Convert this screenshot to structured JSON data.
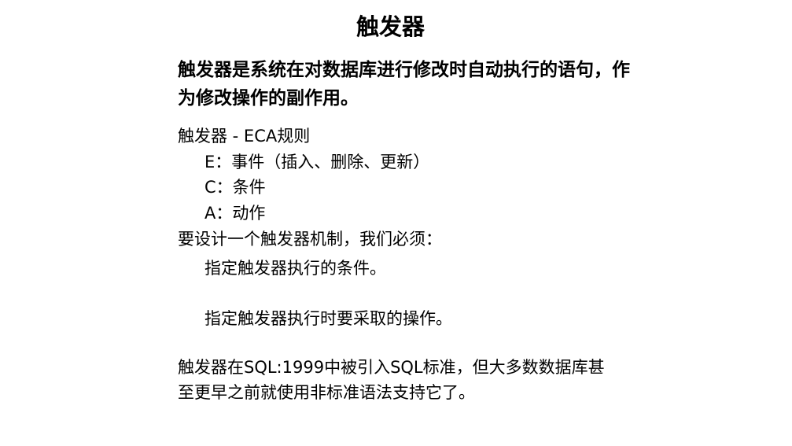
{
  "slide": {
    "title": "触发器",
    "lead": "触发器是系统在对数据库进行修改时自动执行的语句，作为修改操作的副作用。",
    "eca_heading": "触发器 - ECA规则",
    "eca_items": [
      "E：事件（插入、删除、更新）",
      "C：条件",
      "A：动作"
    ],
    "design_heading": "要设计一个触发器机制，我们必须：",
    "design_items": [
      "指定触发器执行的条件。",
      "指定触发器执行时要采取的操作。"
    ],
    "closing": "触发器在SQL:1999中被引入SQL标准，但大多数数据库甚至更早之前就使用非标准语法支持它了。"
  }
}
